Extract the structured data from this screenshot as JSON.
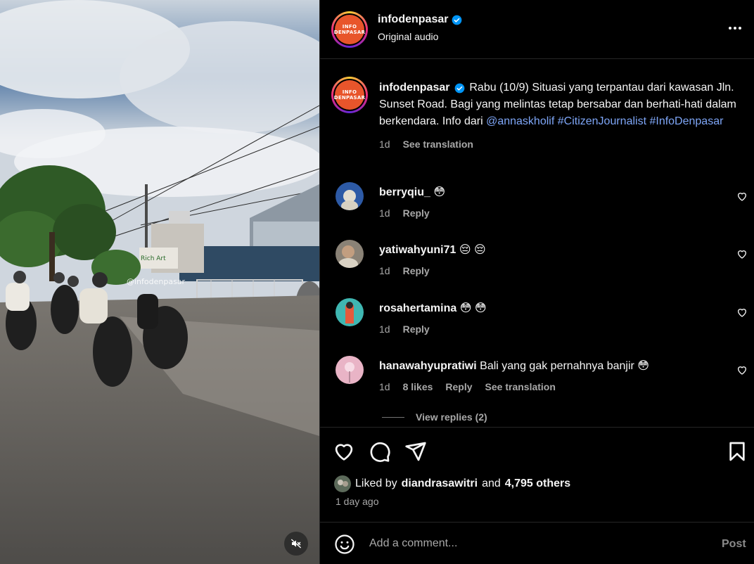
{
  "post": {
    "username": "infodenpasar",
    "audio": "Original audio",
    "watermark": "@infodenpasar",
    "logo_line1": "INFO",
    "logo_line2": "DENPASAR",
    "brand_color": "#e8552b"
  },
  "caption": {
    "username": "infodenpasar",
    "text": "Rabu (10/9) Situasi yang terpantau dari kawasan Jln. Sunset Road. Bagi yang melintas tetap bersabar dan berhati-hati dalam berkendara. Info dari ",
    "mention": "@annaskholif",
    "hashtag1": "#CitizenJournalist",
    "hashtag2": "#InfoDenpasar",
    "time": "1d",
    "translate": "See translation"
  },
  "comments": [
    {
      "username": "berryqiu_",
      "text": "😳",
      "time": "1d",
      "reply": "Reply"
    },
    {
      "username": "yatiwahyuni71",
      "text": "😔 😔",
      "time": "1d",
      "reply": "Reply"
    },
    {
      "username": "rosahertamina",
      "text": "😳 😳",
      "time": "1d",
      "reply": "Reply"
    },
    {
      "username": "hanawahyupratiwi",
      "text": "Bali yang gak pernahnya banjir 😳",
      "time": "1d",
      "likes": "8 likes",
      "reply": "Reply",
      "translate": "See translation",
      "view_replies": "View replies (2)"
    }
  ],
  "likes": {
    "prefix": "Liked by",
    "user": "diandrasawitri",
    "and": "and",
    "others": "4,795 others"
  },
  "posted_ago": "1 day ago",
  "composer": {
    "placeholder": "Add a comment...",
    "post_label": "Post"
  },
  "colors": {
    "link": "#7ea6f7",
    "muted": "#a8a8a8",
    "verified": "#0095f6"
  }
}
